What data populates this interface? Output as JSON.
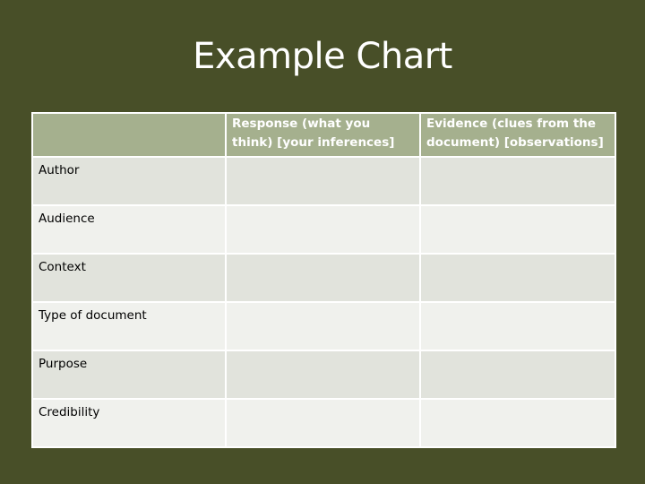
{
  "slide": {
    "title": "Example Chart"
  },
  "table": {
    "headers": [
      "",
      "Response (what you think) [your inferences]",
      "Evidence (clues from the document)  [observations]"
    ],
    "rows": [
      {
        "label": "Author",
        "response": "",
        "evidence": ""
      },
      {
        "label": "Audience",
        "response": "",
        "evidence": ""
      },
      {
        "label": "Context",
        "response": "",
        "evidence": ""
      },
      {
        "label": "Type of document",
        "response": "",
        "evidence": ""
      },
      {
        "label": "Purpose",
        "response": "",
        "evidence": ""
      },
      {
        "label": "Credibility",
        "response": "",
        "evidence": ""
      }
    ]
  }
}
